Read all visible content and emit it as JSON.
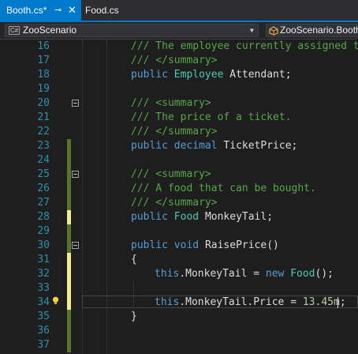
{
  "tabs": {
    "active": "Booth.cs*",
    "inactive": "Food.cs",
    "pin_icon": "⊸",
    "close_icon": "✕"
  },
  "navbar": {
    "language_badge": "C#",
    "project": "ZooScenario",
    "class": "ZooScenario.Booth"
  },
  "colors": {
    "accent": "#007acc",
    "comment": "#57a64a",
    "keyword": "#569cd6",
    "type": "#4ec9b0",
    "number": "#b5cea8",
    "line_number": "#2b91af",
    "saved_change": "#577430",
    "unsaved_change": "#efef91"
  },
  "lines": [
    {
      "n": "16",
      "text": "/// The employee currently assigned to"
    },
    {
      "n": "17",
      "text": "/// </summary>"
    },
    {
      "n": "18",
      "text": "public Employee Attendant;"
    },
    {
      "n": "19",
      "text": ""
    },
    {
      "n": "20",
      "text": "/// <summary>"
    },
    {
      "n": "21",
      "text": "/// The price of a ticket."
    },
    {
      "n": "22",
      "text": "/// </summary>"
    },
    {
      "n": "23",
      "text": "public decimal TicketPrice;"
    },
    {
      "n": "24",
      "text": ""
    },
    {
      "n": "25",
      "text": "/// <summary>"
    },
    {
      "n": "26",
      "text": "/// A food that can be bought."
    },
    {
      "n": "27",
      "text": "/// </summary>"
    },
    {
      "n": "28",
      "text": "public Food MonkeyTail;"
    },
    {
      "n": "29",
      "text": ""
    },
    {
      "n": "30",
      "text": "public void RaisePrice()"
    },
    {
      "n": "31",
      "text": "{"
    },
    {
      "n": "32",
      "text": "this.MonkeyTail = new Food();"
    },
    {
      "n": "33",
      "text": ""
    },
    {
      "n": "34",
      "text": "this.MonkeyTail.Price = 13.45m;"
    },
    {
      "n": "35",
      "text": "}"
    },
    {
      "n": "36",
      "text": ""
    },
    {
      "n": "37",
      "text": ""
    }
  ],
  "lightbulb_icon": "lightbulb-icon"
}
